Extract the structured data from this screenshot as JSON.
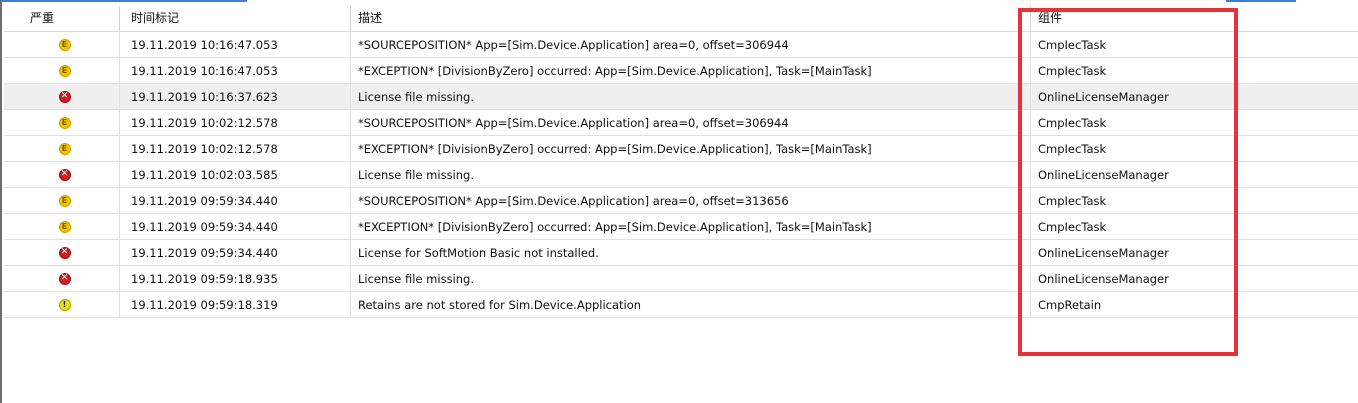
{
  "columns": {
    "severity": "严重",
    "timestamp": "时间标记",
    "description": "描述",
    "component": "组件"
  },
  "icons": {
    "warning": "exception-warning-icon",
    "error": "error-x-icon",
    "info": "info-exclamation-icon",
    "warning_glyph": "E",
    "error_glyph": "✕",
    "info_glyph": "!"
  },
  "rows": [
    {
      "severity": "warning",
      "time": "19.11.2019 10:16:47.053",
      "description": "*SOURCEPOSITION* App=[Sim.Device.Application] area=0, offset=306944",
      "component": "CmpIecTask"
    },
    {
      "severity": "warning",
      "time": "19.11.2019 10:16:47.053",
      "description": "*EXCEPTION* [DivisionByZero] occurred: App=[Sim.Device.Application], Task=[MainTask]",
      "component": "CmpIecTask"
    },
    {
      "severity": "error",
      "time": "19.11.2019 10:16:37.623",
      "description": "License file missing.",
      "component": "OnlineLicenseManager"
    },
    {
      "severity": "warning",
      "time": "19.11.2019 10:02:12.578",
      "description": "*SOURCEPOSITION* App=[Sim.Device.Application] area=0, offset=306944",
      "component": "CmpIecTask"
    },
    {
      "severity": "warning",
      "time": "19.11.2019 10:02:12.578",
      "description": "*EXCEPTION* [DivisionByZero] occurred: App=[Sim.Device.Application], Task=[MainTask]",
      "component": "CmpIecTask"
    },
    {
      "severity": "error",
      "time": "19.11.2019 10:02:03.585",
      "description": "License file missing.",
      "component": "OnlineLicenseManager"
    },
    {
      "severity": "warning",
      "time": "19.11.2019 09:59:34.440",
      "description": "*SOURCEPOSITION* App=[Sim.Device.Application] area=0, offset=313656",
      "component": "CmpIecTask"
    },
    {
      "severity": "warning",
      "time": "19.11.2019 09:59:34.440",
      "description": "*EXCEPTION* [DivisionByZero] occurred: App=[Sim.Device.Application], Task=[MainTask]",
      "component": "CmpIecTask"
    },
    {
      "severity": "error",
      "time": "19.11.2019 09:59:34.440",
      "description": "License for SoftMotion Basic not installed.",
      "component": "OnlineLicenseManager"
    },
    {
      "severity": "error",
      "time": "19.11.2019 09:59:18.935",
      "description": "License file missing.",
      "component": "OnlineLicenseManager"
    },
    {
      "severity": "info",
      "time": "19.11.2019 09:59:18.319",
      "description": "Retains are not stored for Sim.Device.Application",
      "component": "CmpRetain"
    }
  ],
  "selected_row": 2,
  "colors": {
    "highlight_border": "#e8313a",
    "warning_fill": "#f2c500",
    "error_fill": "#d01e1e",
    "info_fill": "#ece100",
    "selected_row_bg": "#efefef"
  }
}
